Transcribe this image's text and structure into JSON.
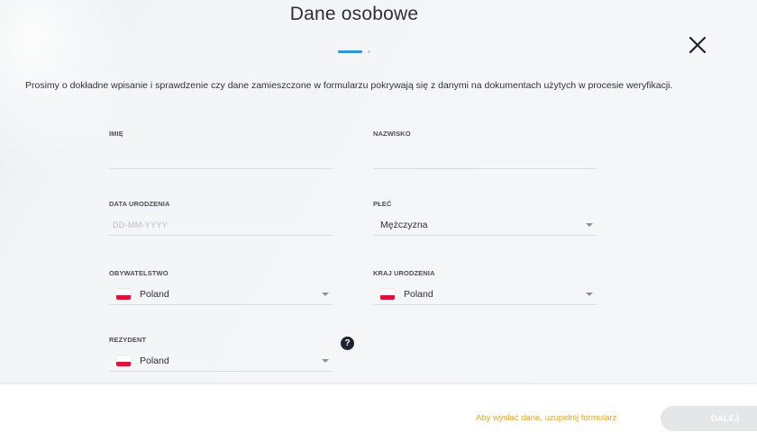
{
  "header": {
    "title": "Dane osobowe"
  },
  "intro_text": "Prosimy o dokładne wpisanie i sprawdzenie czy dane zamieszczone w formularzu pokrywają się z danymi na dokumentach użytych w procesie weryfikacji.",
  "form": {
    "first_name": {
      "label": "IMIĘ",
      "value": ""
    },
    "last_name": {
      "label": "NAZWISKO",
      "value": ""
    },
    "birth_date": {
      "label": "DATA URODZENIA",
      "placeholder": "DD-MM-YYYY"
    },
    "gender": {
      "label": "PŁEĆ",
      "value": "Mężczyzna"
    },
    "citizenship": {
      "label": "OBYWATELSTWO",
      "value": "Poland",
      "flag": "poland-flag-icon"
    },
    "birth_country": {
      "label": "KRAJ URODZENIA",
      "value": "Poland",
      "flag": "poland-flag-icon"
    },
    "resident": {
      "label": "REZYDENT",
      "value": "Poland",
      "flag": "poland-flag-icon"
    }
  },
  "help_icon": {
    "glyph": "?"
  },
  "footer": {
    "message": "Aby wysłać dane, uzupełnij formularz",
    "submit_label": "DALEJ"
  },
  "colors": {
    "accent": "#2f95d8",
    "warning_text": "#e6a52b",
    "flag_white": "#ffffff",
    "flag_red": "#dc143c"
  }
}
